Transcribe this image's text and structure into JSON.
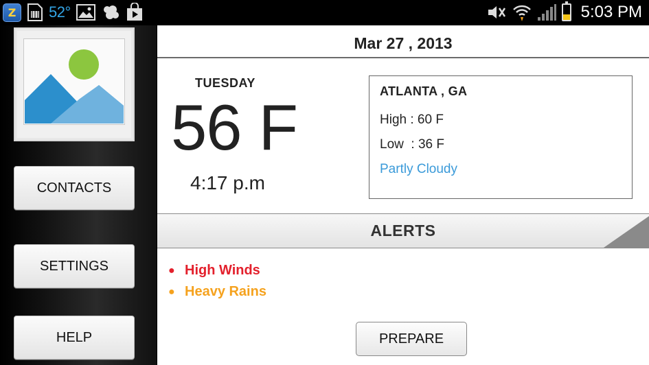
{
  "status_bar": {
    "app_icon_letter": "Z",
    "temperature": "52°",
    "time": "5:03 PM",
    "icons": [
      "z-app-icon",
      "sim-card-icon",
      "image-icon",
      "weather-icon",
      "shopping-bag-icon",
      "mute-icon",
      "wifi-icon",
      "signal-icon",
      "battery-icon"
    ]
  },
  "sidebar": {
    "photo_icon": "image-placeholder-icon",
    "buttons": {
      "contacts": "CONTACTS",
      "settings": "SETTINGS",
      "help": "HELP"
    }
  },
  "main": {
    "date": "Mar 27 , 2013",
    "day": "TUESDAY",
    "temperature": "56 F",
    "time": "4:17 p.m",
    "weather": {
      "location": "ATLANTA , GA",
      "high": "High : 60 F",
      "low": "Low  : 36 F",
      "condition": "Partly Cloudy"
    },
    "alerts_title": "ALERTS",
    "alerts": [
      {
        "text": "High Winds",
        "color": "#e3202c"
      },
      {
        "text": "Heavy Rains",
        "color": "#f5a21e"
      }
    ],
    "prepare_label": "PREPARE"
  },
  "colors": {
    "accent_blue": "#3a9ad9",
    "status_temp": "#33a5e6",
    "alert_red": "#e3202c",
    "alert_orange": "#f5a21e"
  }
}
